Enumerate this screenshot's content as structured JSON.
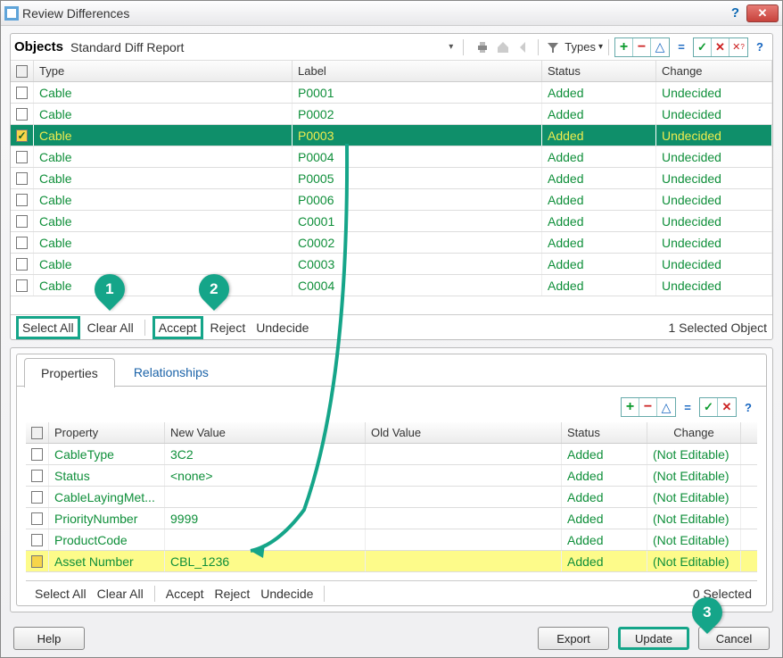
{
  "window": {
    "title": "Review Differences"
  },
  "upper": {
    "objects_label": "Objects",
    "view_name": "Standard Diff Report",
    "type_filter_label": "Types",
    "columns": {
      "type": "Type",
      "label": "Label",
      "status": "Status",
      "change": "Change"
    },
    "rows": [
      {
        "checked": false,
        "type": "Cable",
        "label": "P0001",
        "status": "Added",
        "change": "Undecided",
        "selected": false
      },
      {
        "checked": false,
        "type": "Cable",
        "label": "P0002",
        "status": "Added",
        "change": "Undecided",
        "selected": false
      },
      {
        "checked": true,
        "type": "Cable",
        "label": "P0003",
        "status": "Added",
        "change": "Undecided",
        "selected": true
      },
      {
        "checked": false,
        "type": "Cable",
        "label": "P0004",
        "status": "Added",
        "change": "Undecided",
        "selected": false
      },
      {
        "checked": false,
        "type": "Cable",
        "label": "P0005",
        "status": "Added",
        "change": "Undecided",
        "selected": false
      },
      {
        "checked": false,
        "type": "Cable",
        "label": "P0006",
        "status": "Added",
        "change": "Undecided",
        "selected": false
      },
      {
        "checked": false,
        "type": "Cable",
        "label": "C0001",
        "status": "Added",
        "change": "Undecided",
        "selected": false
      },
      {
        "checked": false,
        "type": "Cable",
        "label": "C0002",
        "status": "Added",
        "change": "Undecided",
        "selected": false
      },
      {
        "checked": false,
        "type": "Cable",
        "label": "C0003",
        "status": "Added",
        "change": "Undecided",
        "selected": false
      },
      {
        "checked": false,
        "type": "Cable",
        "label": "C0004",
        "status": "Added",
        "change": "Undecided",
        "selected": false
      }
    ],
    "actions": {
      "select_all": "Select All",
      "clear_all": "Clear All",
      "accept": "Accept",
      "reject": "Reject",
      "undecide": "Undecide"
    },
    "selection_text": "1 Selected Object"
  },
  "lower": {
    "tabs": {
      "properties": "Properties",
      "relationships": "Relationships"
    },
    "columns": {
      "property": "Property",
      "new_value": "New Value",
      "old_value": "Old Value",
      "status": "Status",
      "change": "Change"
    },
    "rows": [
      {
        "property": "CableType",
        "new_value": "3C2",
        "old_value": "",
        "status": "Added",
        "change": "(Not Editable)",
        "highlight": false
      },
      {
        "property": "Status",
        "new_value": "<none>",
        "old_value": "",
        "status": "Added",
        "change": "(Not Editable)",
        "highlight": false
      },
      {
        "property": "CableLayingMet...",
        "new_value": "",
        "old_value": "",
        "status": "Added",
        "change": "(Not Editable)",
        "highlight": false
      },
      {
        "property": "PriorityNumber",
        "new_value": "9999",
        "old_value": "",
        "status": "Added",
        "change": "(Not Editable)",
        "highlight": false
      },
      {
        "property": "ProductCode",
        "new_value": "",
        "old_value": "",
        "status": "Added",
        "change": "(Not Editable)",
        "highlight": false
      },
      {
        "property": "Asset Number",
        "new_value": "CBL_1236",
        "old_value": "",
        "status": "Added",
        "change": "(Not Editable)",
        "highlight": true
      }
    ],
    "actions": {
      "select_all": "Select All",
      "clear_all": "Clear All",
      "accept": "Accept",
      "reject": "Reject",
      "undecide": "Undecide"
    },
    "selection_text": "0 Selected"
  },
  "footer": {
    "help": "Help",
    "export": "Export",
    "update": "Update",
    "cancel": "Cancel"
  },
  "callouts": {
    "c1": "1",
    "c2": "2",
    "c3": "3"
  }
}
